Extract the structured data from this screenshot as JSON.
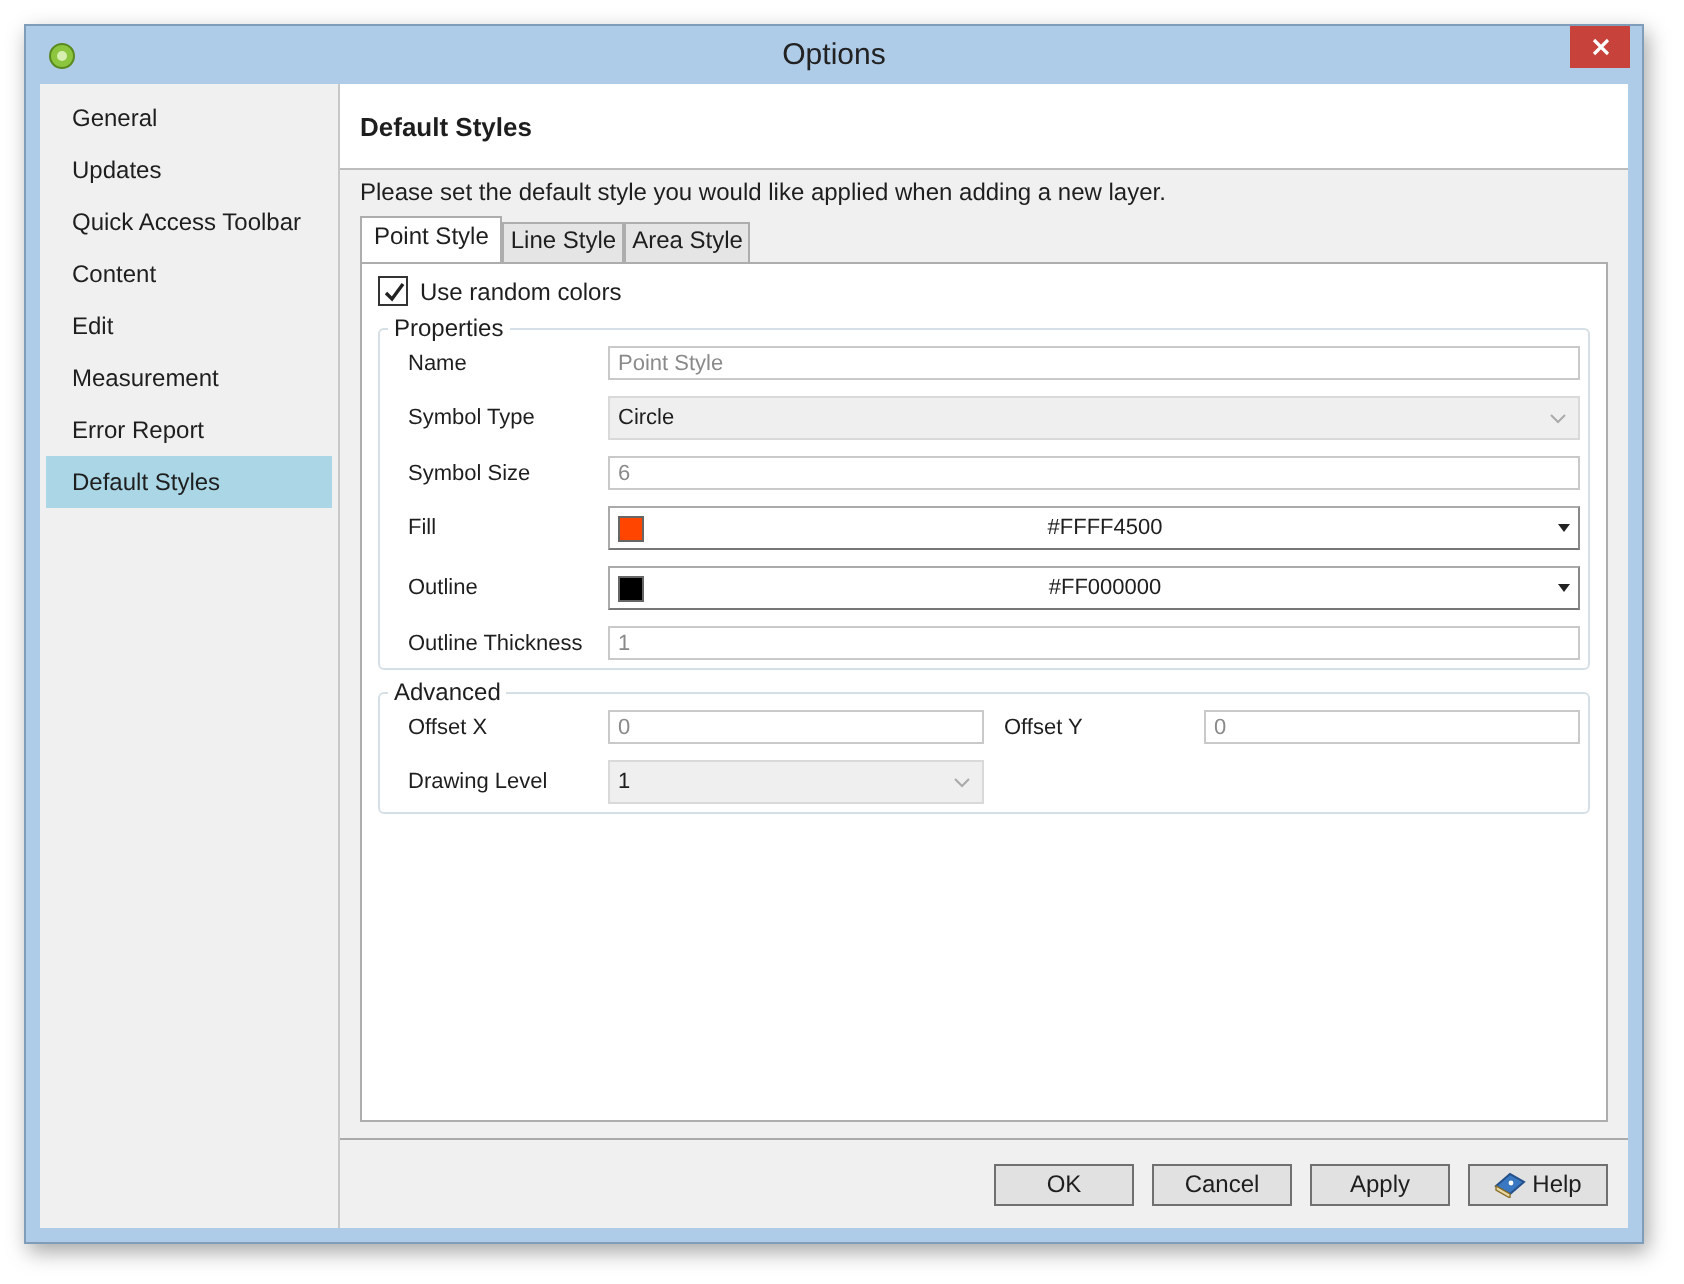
{
  "window": {
    "title": "Options"
  },
  "sidebar": {
    "items": [
      {
        "label": "General",
        "selected": false
      },
      {
        "label": "Updates",
        "selected": false
      },
      {
        "label": "Quick Access Toolbar",
        "selected": false
      },
      {
        "label": "Content",
        "selected": false
      },
      {
        "label": "Edit",
        "selected": false
      },
      {
        "label": "Measurement",
        "selected": false
      },
      {
        "label": "Error Report",
        "selected": false
      },
      {
        "label": "Default Styles",
        "selected": true
      }
    ]
  },
  "page": {
    "title": "Default Styles",
    "description": "Please set the default style you would like applied when adding a new layer."
  },
  "tabs": [
    {
      "label": "Point Style",
      "selected": true
    },
    {
      "label": "Line Style",
      "selected": false
    },
    {
      "label": "Area Style",
      "selected": false
    }
  ],
  "random_colors": {
    "label": "Use random colors",
    "checked": true
  },
  "properties": {
    "title": "Properties",
    "fields": [
      {
        "label": "Name",
        "kind": "text",
        "value": "Point Style",
        "disabled": true
      },
      {
        "label": "Symbol Type",
        "kind": "combo",
        "value": "Circle",
        "disabled": true
      },
      {
        "label": "Symbol Size",
        "kind": "text",
        "value": "6",
        "disabled": true
      },
      {
        "label": "Fill",
        "kind": "color",
        "value": "#FFFF4500",
        "color": "#ff4500",
        "disabled": false
      },
      {
        "label": "Outline",
        "kind": "color",
        "value": "#FF000000",
        "color": "#000000",
        "disabled": false
      },
      {
        "label": "Outline Thickness",
        "kind": "text",
        "value": "1",
        "disabled": true
      }
    ]
  },
  "advanced": {
    "title": "Advanced",
    "fields": [
      {
        "label": "Offset X",
        "kind": "text",
        "value": "0",
        "disabled": true
      },
      {
        "label": "Offset Y",
        "kind": "text",
        "value": "0",
        "disabled": true
      },
      {
        "label": "Drawing Level",
        "kind": "combo",
        "value": "1",
        "disabled": true
      }
    ]
  },
  "buttons": [
    {
      "label": "OK",
      "kind": "plain"
    },
    {
      "label": "Cancel",
      "kind": "plain"
    },
    {
      "label": "Apply",
      "kind": "plain"
    },
    {
      "label": "Help",
      "kind": "help"
    }
  ]
}
